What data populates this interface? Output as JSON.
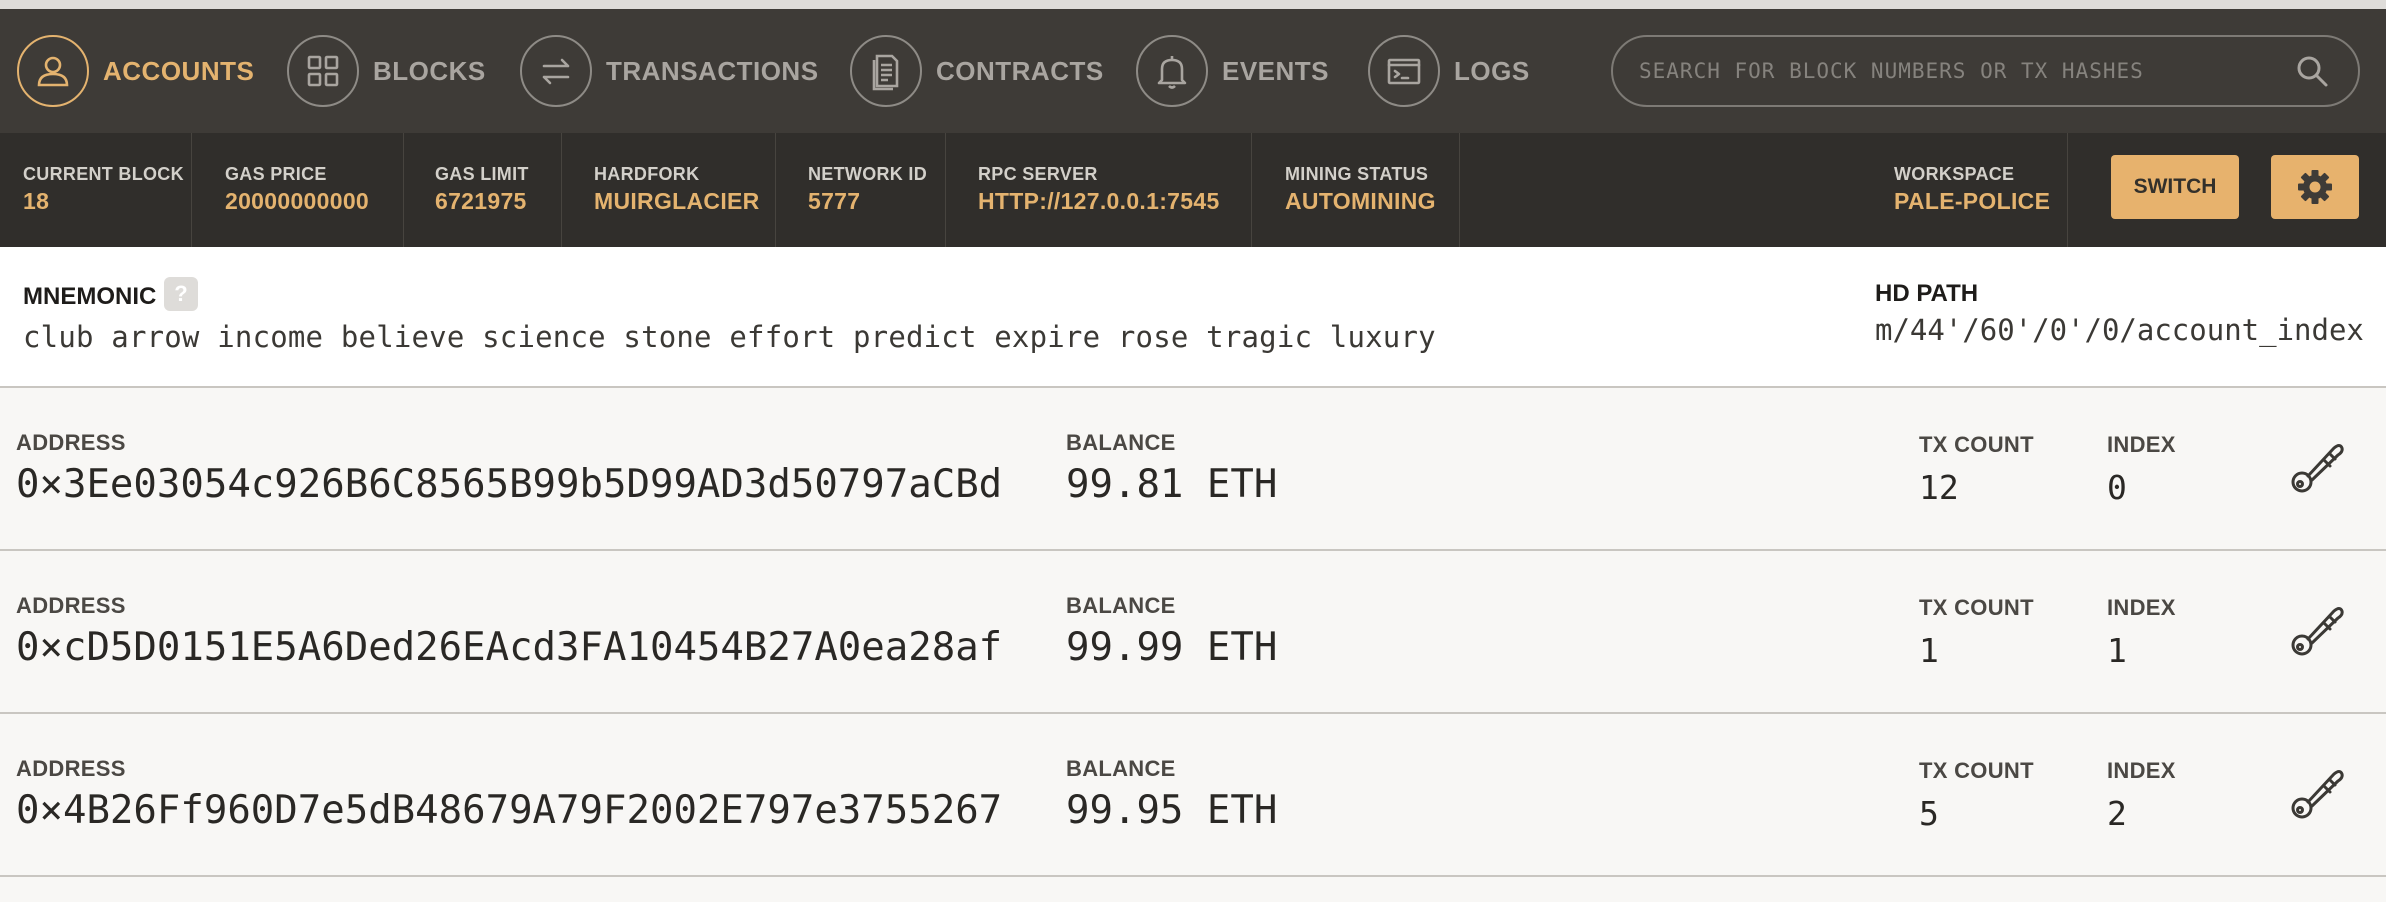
{
  "nav": {
    "items": [
      {
        "label": "ACCOUNTS",
        "icon": "user-icon",
        "active": true
      },
      {
        "label": "BLOCKS",
        "icon": "grid-icon",
        "active": false
      },
      {
        "label": "TRANSACTIONS",
        "icon": "swap-arrows-icon",
        "active": false
      },
      {
        "label": "CONTRACTS",
        "icon": "document-icon",
        "active": false
      },
      {
        "label": "EVENTS",
        "icon": "bell-icon",
        "active": false
      },
      {
        "label": "LOGS",
        "icon": "terminal-icon",
        "active": false
      }
    ],
    "search_placeholder": "SEARCH FOR BLOCK NUMBERS OR TX HASHES"
  },
  "status": {
    "current_block_label": "CURRENT BLOCK",
    "current_block": "18",
    "gas_price_label": "GAS PRICE",
    "gas_price": "20000000000",
    "gas_limit_label": "GAS LIMIT",
    "gas_limit": "6721975",
    "hardfork_label": "HARDFORK",
    "hardfork": "MUIRGLACIER",
    "network_id_label": "NETWORK ID",
    "network_id": "5777",
    "rpc_server_label": "RPC SERVER",
    "rpc_server": "HTTP://127.0.0.1:7545",
    "mining_status_label": "MINING STATUS",
    "mining_status": "AUTOMINING",
    "workspace_label": "WORKSPACE",
    "workspace": "PALE-POLICE",
    "switch_label": "SWITCH"
  },
  "mnemonic": {
    "title": "MNEMONIC",
    "help": "?",
    "words": "club arrow income believe science stone effort predict expire rose tragic luxury",
    "hd_path_label": "HD PATH",
    "hd_path": "m/44'/60'/0'/0/account_index"
  },
  "accounts": [
    {
      "address_label": "ADDRESS",
      "address": "0×3Ee03054c926B6C8565B99b5D99AD3d50797aCBd",
      "balance_label": "BALANCE",
      "balance": "99.81 ETH",
      "tx_count_label": "TX COUNT",
      "tx_count": "12",
      "index_label": "INDEX",
      "index": "0"
    },
    {
      "address_label": "ADDRESS",
      "address": "0×cD5D0151E5A6Ded26EAcd3FA10454B27A0ea28af",
      "balance_label": "BALANCE",
      "balance": "99.99 ETH",
      "tx_count_label": "TX COUNT",
      "tx_count": "1",
      "index_label": "INDEX",
      "index": "1"
    },
    {
      "address_label": "ADDRESS",
      "address": "0×4B26Ff960D7e5dB48679A79F2002E797e3755267",
      "balance_label": "BALANCE",
      "balance": "99.95 ETH",
      "tx_count_label": "TX COUNT",
      "tx_count": "5",
      "index_label": "INDEX",
      "index": "2"
    }
  ],
  "colors": {
    "accent": "#e4b36f",
    "nav_bg": "#3e3b37",
    "status_bg": "#302e2b"
  }
}
